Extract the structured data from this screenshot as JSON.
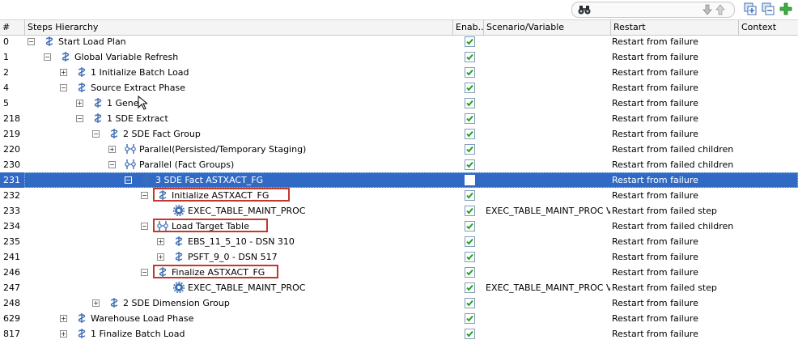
{
  "toolbar": {
    "search_icon": "binoculars-icon",
    "move_down_icon": "arrow-down-icon",
    "move_up_icon": "arrow-up-icon",
    "expand_icon": "expand-all-icon",
    "collapse_icon": "collapse-all-icon",
    "add_icon": "add-step-icon"
  },
  "columns": {
    "num": "#",
    "steps": "Steps Hierarchy",
    "enabled": "Enab...",
    "scenario": "Scenario/Variable",
    "restart": "Restart",
    "context": "Context"
  },
  "colors": {
    "selection": "#316ac5",
    "highlight_box": "#c0392b",
    "step_icon": "#3f6fb5"
  },
  "rows": [
    {
      "num": "0",
      "level": 0,
      "expander": "minus",
      "icon": "serial-step-icon",
      "label": "Start Load Plan",
      "enabled": true,
      "scenario": "",
      "restart": "Restart from failure"
    },
    {
      "num": "1",
      "level": 1,
      "expander": "minus",
      "icon": "serial-step-icon",
      "label": "Global Variable Refresh",
      "enabled": true,
      "scenario": "",
      "restart": "Restart from failure"
    },
    {
      "num": "2",
      "level": 2,
      "expander": "plus",
      "icon": "serial-step-icon",
      "label": "1 Initialize Batch Load",
      "enabled": true,
      "scenario": "",
      "restart": "Restart from failure"
    },
    {
      "num": "4",
      "level": 2,
      "expander": "minus",
      "icon": "serial-step-icon",
      "label": "Source Extract Phase",
      "enabled": true,
      "scenario": "",
      "restart": "Restart from failure"
    },
    {
      "num": "5",
      "level": 3,
      "expander": "plus",
      "icon": "serial-step-icon",
      "label": "1 Gener",
      "enabled": true,
      "scenario": "",
      "restart": "Restart from failure"
    },
    {
      "num": "218",
      "level": 3,
      "expander": "minus",
      "icon": "serial-step-icon",
      "label": "1 SDE Extract",
      "enabled": true,
      "scenario": "",
      "restart": "Restart from failure"
    },
    {
      "num": "219",
      "level": 4,
      "expander": "minus",
      "icon": "serial-step-icon",
      "label": "2 SDE Fact Group",
      "enabled": true,
      "scenario": "",
      "restart": "Restart from failure"
    },
    {
      "num": "220",
      "level": 5,
      "expander": "plus",
      "icon": "parallel-step-icon",
      "label": "Parallel(Persisted/Temporary Staging)",
      "enabled": true,
      "scenario": "",
      "restart": "Restart from failed children"
    },
    {
      "num": "230",
      "level": 5,
      "expander": "minus",
      "icon": "parallel-step-icon",
      "label": "Parallel (Fact Groups)",
      "enabled": true,
      "scenario": "",
      "restart": "Restart from failed children"
    },
    {
      "num": "231",
      "level": 6,
      "expander": "minus",
      "icon": "serial-step-icon",
      "label": "3 SDE Fact ASTXACT_FG",
      "enabled": true,
      "scenario": "",
      "restart": "Restart from failure",
      "selected": true
    },
    {
      "num": "232",
      "level": 7,
      "expander": "minus",
      "icon": "serial-step-icon",
      "label": "Initialize ASTXACT_FG",
      "enabled": true,
      "scenario": "",
      "restart": "Restart from failure",
      "boxed": true
    },
    {
      "num": "233",
      "level": 8,
      "expander": "none",
      "icon": "scenario-gear-icon",
      "label": "EXEC_TABLE_MAINT_PROC",
      "enabled": true,
      "scenario": "EXEC_TABLE_MAINT_PROC V...",
      "restart": "Restart from failed step"
    },
    {
      "num": "234",
      "level": 7,
      "expander": "minus",
      "icon": "parallel-step-icon",
      "label": "Load Target Table",
      "enabled": true,
      "scenario": "",
      "restart": "Restart from failed children",
      "boxed": true
    },
    {
      "num": "235",
      "level": 8,
      "expander": "plus",
      "icon": "serial-step-icon",
      "label": "EBS_11_5_10 - DSN 310",
      "enabled": true,
      "scenario": "",
      "restart": "Restart from failure"
    },
    {
      "num": "241",
      "level": 8,
      "expander": "plus",
      "icon": "serial-step-icon",
      "label": "PSFT_9_0 - DSN 517",
      "enabled": true,
      "scenario": "",
      "restart": "Restart from failure"
    },
    {
      "num": "246",
      "level": 7,
      "expander": "minus",
      "icon": "serial-step-icon",
      "label": "Finalize ASTXACT_FG",
      "enabled": true,
      "scenario": "",
      "restart": "Restart from failure",
      "boxed": true
    },
    {
      "num": "247",
      "level": 8,
      "expander": "none",
      "icon": "scenario-gear-icon",
      "label": "EXEC_TABLE_MAINT_PROC",
      "enabled": true,
      "scenario": "EXEC_TABLE_MAINT_PROC V...",
      "restart": "Restart from failed step"
    },
    {
      "num": "248",
      "level": 4,
      "expander": "plus",
      "icon": "serial-step-icon",
      "label": "2 SDE Dimension Group",
      "enabled": true,
      "scenario": "",
      "restart": "Restart from failure"
    },
    {
      "num": "629",
      "level": 2,
      "expander": "plus",
      "icon": "serial-step-icon",
      "label": "Warehouse Load Phase",
      "enabled": true,
      "scenario": "",
      "restart": "Restart from failure"
    },
    {
      "num": "817",
      "level": 2,
      "expander": "plus",
      "icon": "serial-step-icon",
      "label": "1 Finalize Batch Load",
      "enabled": true,
      "scenario": "",
      "restart": "Restart from failure"
    }
  ]
}
